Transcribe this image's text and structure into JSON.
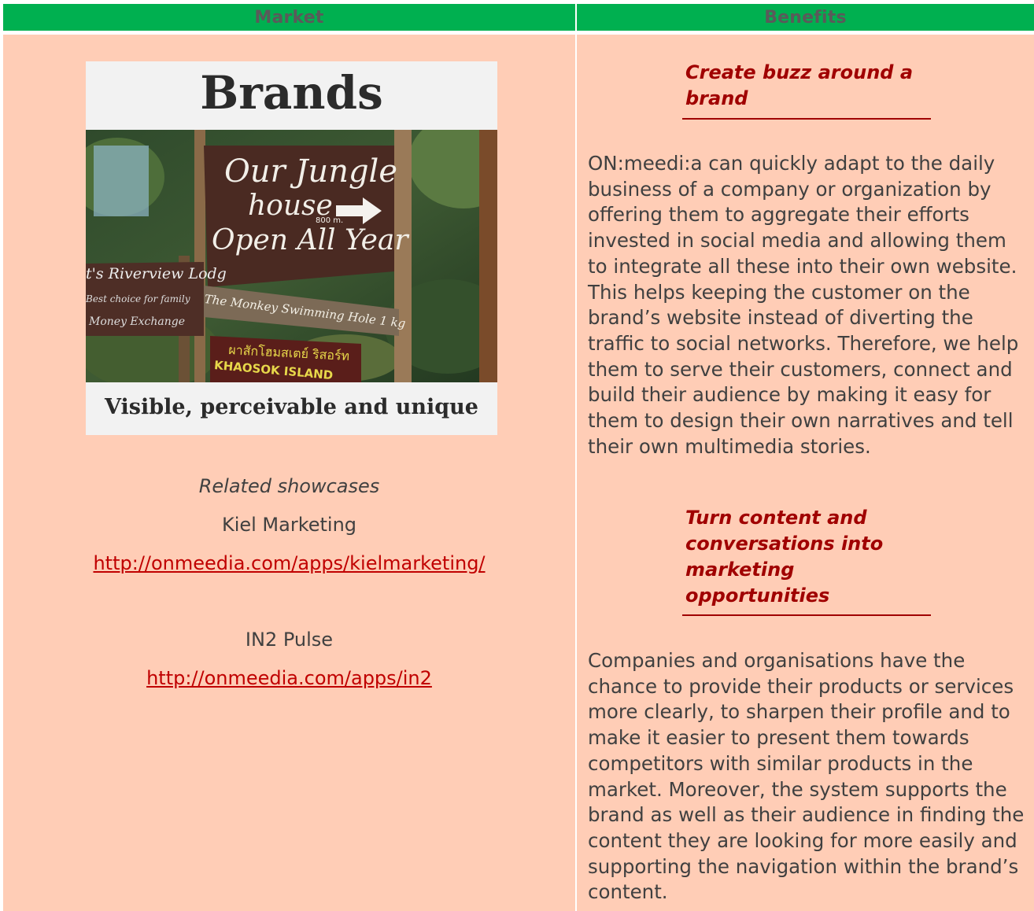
{
  "headers": {
    "market": "Market",
    "benefits": "Benefits"
  },
  "market": {
    "card_title": "Brands",
    "card_caption": "Visible, perceivable and unique",
    "photo_signs": {
      "main_line1": "Our Jungle",
      "main_line2": "house",
      "main_line3": "Open All Year",
      "distance": "800 m.",
      "left_sign1": "t's Riverview Lodg",
      "left_sign2": "Best choice for family",
      "left_sign3": "Money Exchange",
      "mid_sign": "The Monkey Swimming Hole 1 kg",
      "bottom_sign_thai": "ผาสักโฮมสเตย์ ริสอร์ท",
      "bottom_sign": "KHAOSOK ISLAND"
    },
    "related_label": "Related showcases",
    "showcases": [
      {
        "name": "Kiel Marketing",
        "url": "http://onmeedia.com/apps/kielmarketing/"
      },
      {
        "name": "IN2 Pulse",
        "url": "http://onmeedia.com/apps/in2"
      }
    ]
  },
  "benefits": {
    "sections": [
      {
        "heading": "Create buzz around a brand",
        "text": "ON:meedi:a can quickly adapt to the daily business of a company or organization by offering them to aggregate their efforts invested in social media and allowing them to integrate all these into their own website. This helps keeping the customer on the brand’s website instead of diverting the traffic to social networks. Therefore, we help them to serve their customers, connect and build their audience by making it easy for them to design their own narratives and tell their own multimedia stories."
      },
      {
        "heading": "Turn content and conversations into marketing opportunities",
        "text": "Companies and organisations have the chance to provide their products or services more clearly, to sharpen their profile and to make it easier to present them towards competitors with similar products in the market. Moreover, the system supports the brand as well as their audience in finding the content they are looking for more easily and supporting the navigation within the brand’s content."
      }
    ]
  },
  "colors": {
    "header_bg": "#00b050",
    "cell_bg": "#ffcdb6",
    "heading_red": "#a00000",
    "link_red": "#c00000"
  }
}
